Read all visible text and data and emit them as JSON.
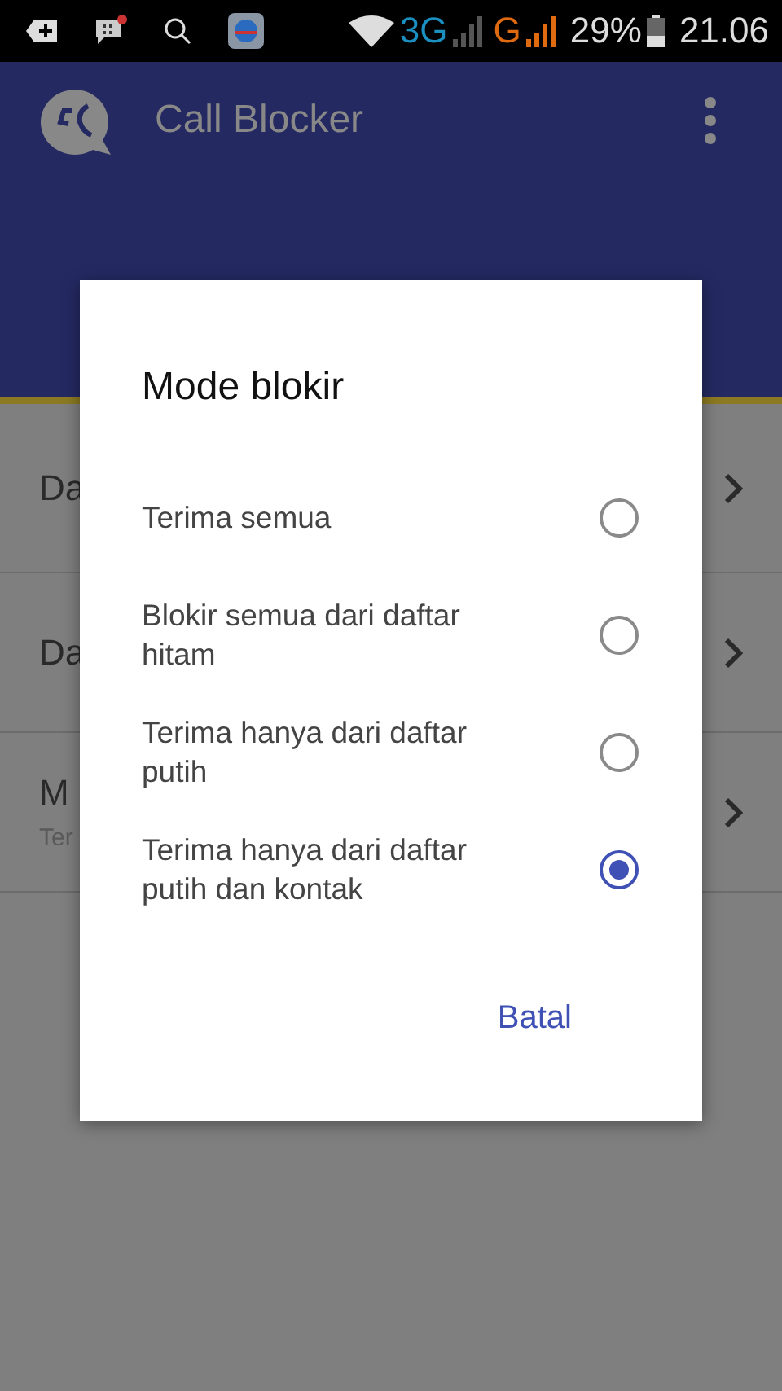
{
  "status_bar": {
    "network_3g": "3G",
    "network_g": "G",
    "battery": "29%",
    "time": "21.06"
  },
  "app_bar": {
    "title": "Call Blocker"
  },
  "list": [
    {
      "title": "Da"
    },
    {
      "title": "Da"
    },
    {
      "title": "M",
      "subtitle": "Ter"
    }
  ],
  "dialog": {
    "title": "Mode blokir",
    "options": [
      {
        "label": "Terima semua",
        "selected": false
      },
      {
        "label": "Blokir semua dari daftar hitam",
        "selected": false
      },
      {
        "label": "Terima hanya dari daftar putih",
        "selected": false
      },
      {
        "label": "Terima hanya dari daftar putih dan kontak",
        "selected": true
      }
    ],
    "buttons": [
      "Batal"
    ]
  }
}
